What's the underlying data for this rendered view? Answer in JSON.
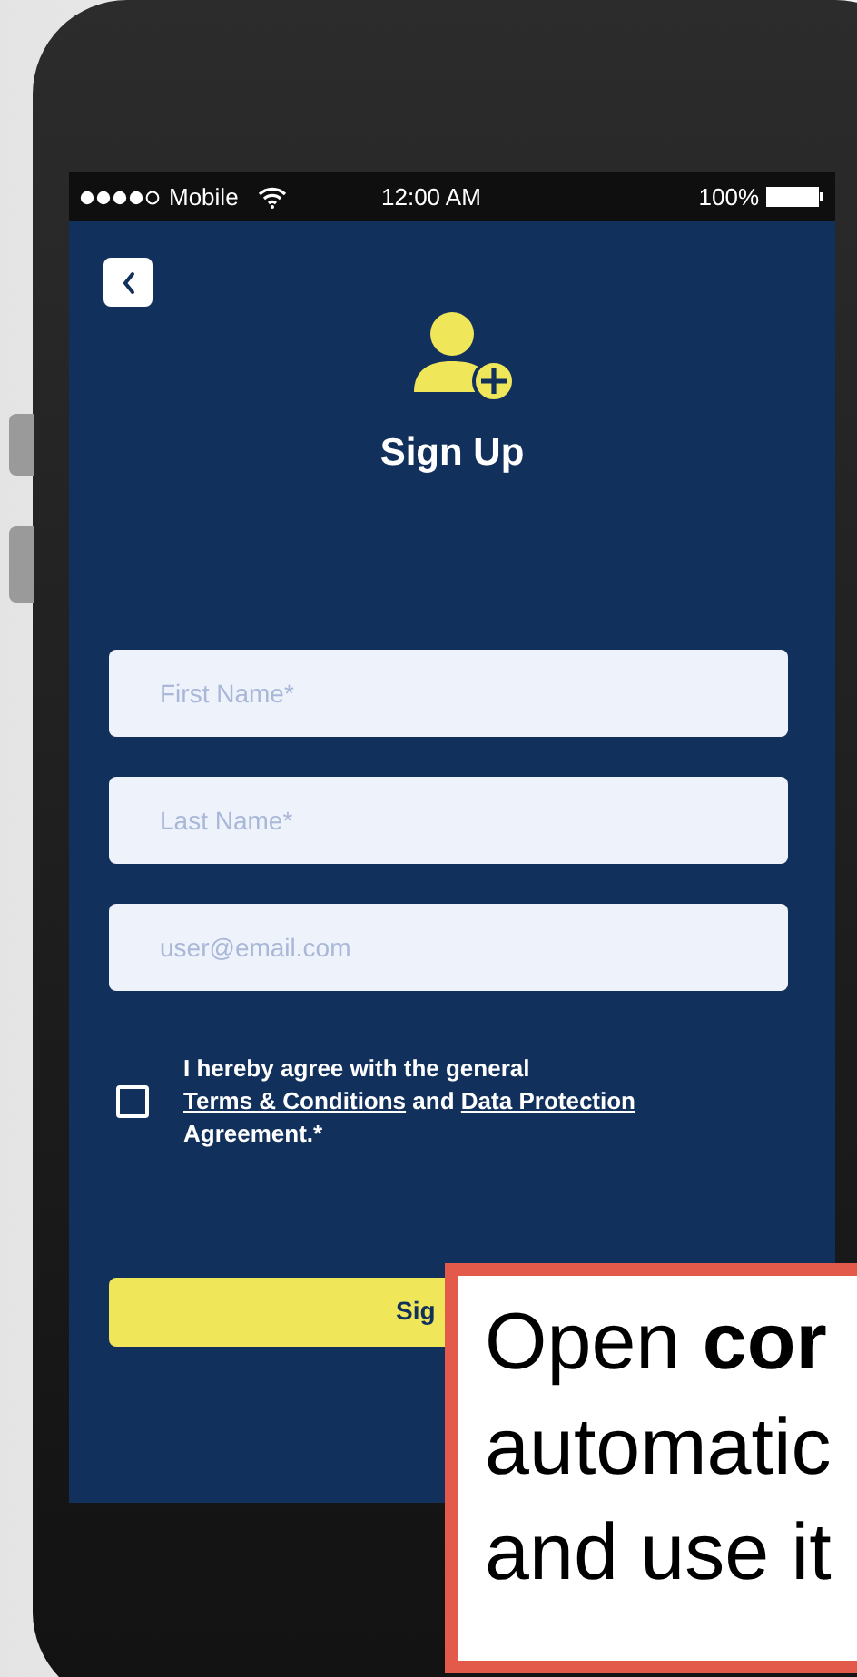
{
  "status_bar": {
    "carrier": "Mobile",
    "time": "12:00 AM",
    "battery": "100%"
  },
  "title": "Sign Up",
  "fields": [
    {
      "placeholder": "First Name*"
    },
    {
      "placeholder": "Last Name*"
    },
    {
      "placeholder": "user@email.com"
    }
  ],
  "agreement": {
    "checked": false,
    "text_1": "I hereby agree with the general",
    "link_1": "Terms & Conditions",
    "text_2": "and",
    "link_2": "Data Protection",
    "text_3": "Agreement.*"
  },
  "submit_button": {
    "label": "Sig"
  },
  "callout": {
    "lines": [
      "Open **cor**",
      "automatic",
      "and use it"
    ]
  }
}
